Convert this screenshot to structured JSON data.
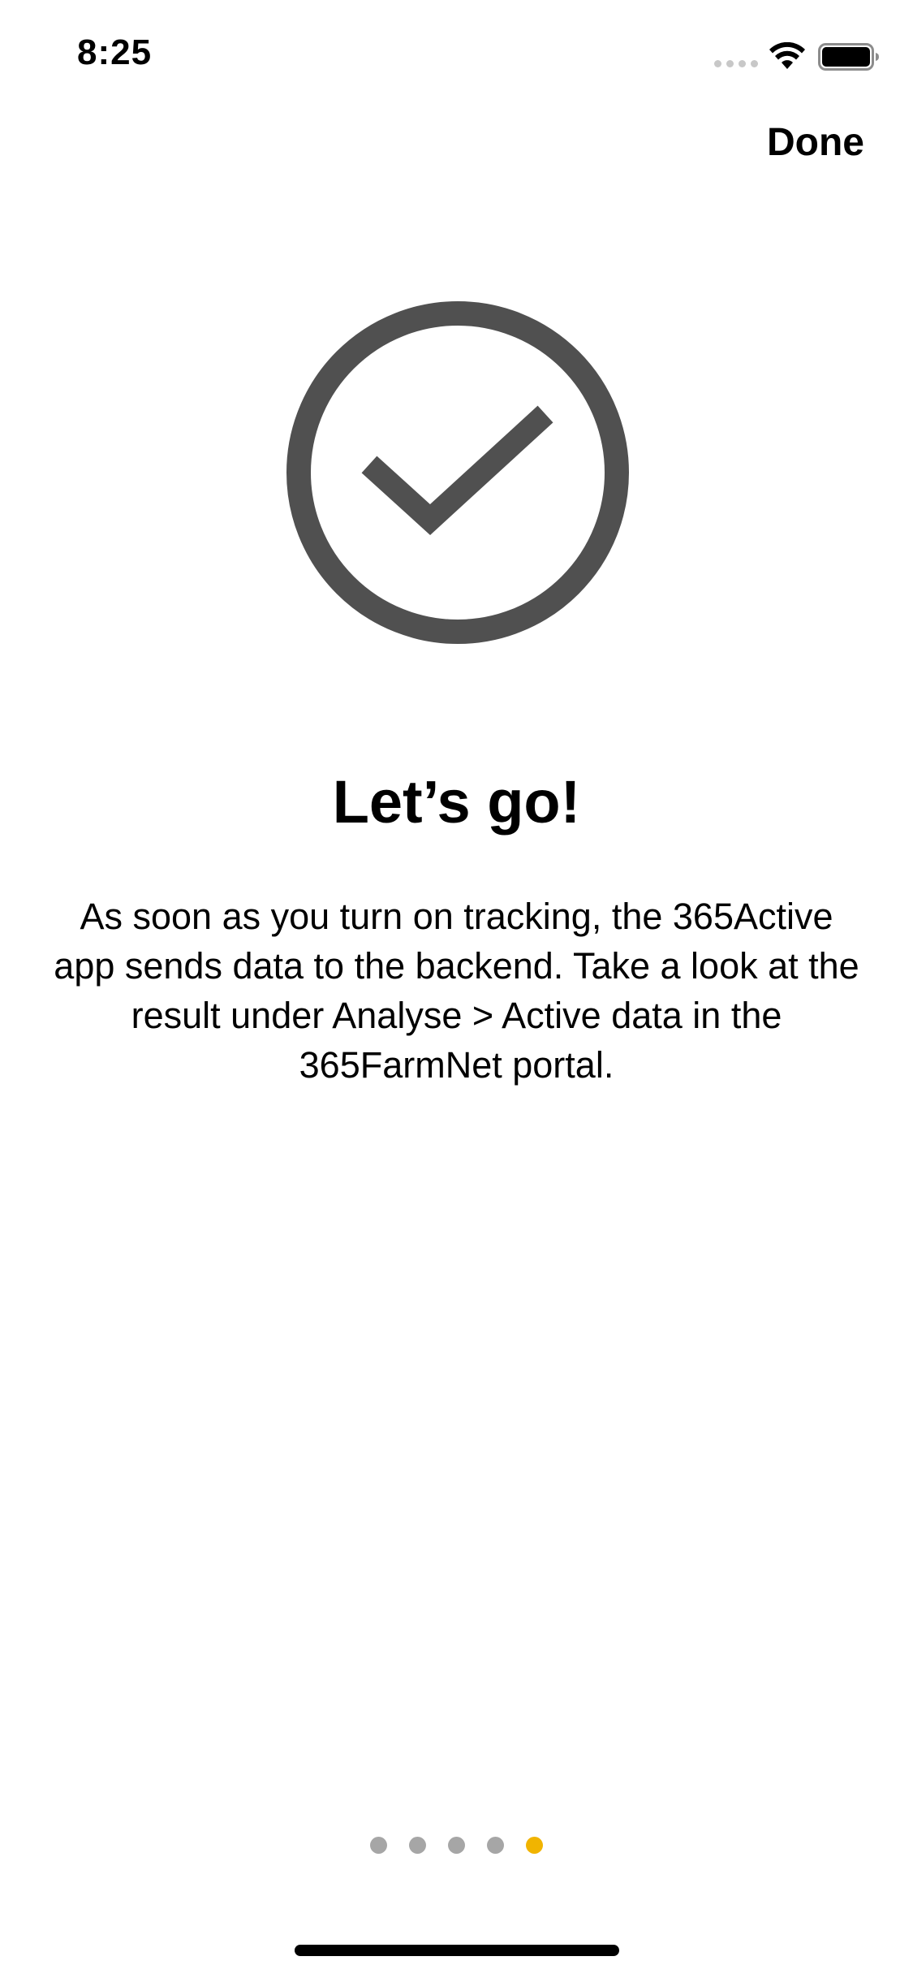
{
  "status_bar": {
    "time": "8:25",
    "icons": [
      "cellular-signal-icon",
      "wifi-icon",
      "battery-icon"
    ]
  },
  "header": {
    "done_label": "Done"
  },
  "onboarding": {
    "illustration_icon": "checkmark-circle-icon",
    "title": "Let’s go!",
    "description": "As soon as you turn on tracking, the 365Active app sends data to the backend. Take a look at the result under Analyse > Active data in the 365FarmNet portal."
  },
  "pager": {
    "total_pages": 5,
    "current_page": 5
  },
  "colors": {
    "icon_gray": "#505050",
    "dot_inactive": "#a6a6a6",
    "dot_active": "#f1b400"
  }
}
